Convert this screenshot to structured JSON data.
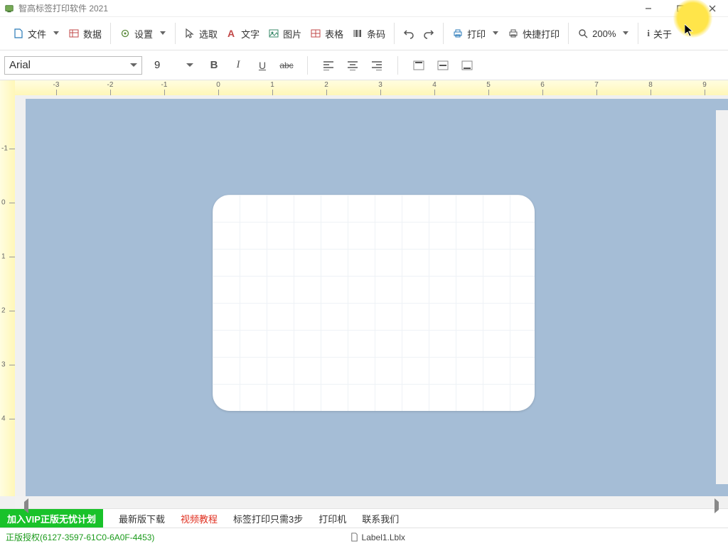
{
  "window": {
    "title": "智高标签打印软件 2021"
  },
  "toolbar": {
    "file": "文件",
    "data": "数据",
    "settings": "设置",
    "select": "选取",
    "text": "文字",
    "image": "图片",
    "table": "表格",
    "barcode": "条码",
    "print": "打印",
    "quick_print": "快捷打印",
    "zoom": "200%",
    "about": "关于"
  },
  "format": {
    "font_name": "Arial",
    "font_size": "9"
  },
  "ruler_h": [
    "-3",
    "-2",
    "-1",
    "0",
    "1",
    "2",
    "3",
    "4",
    "5",
    "6",
    "7",
    "8",
    "9"
  ],
  "ruler_v": [
    "-1",
    "0",
    "1",
    "2",
    "3",
    "4"
  ],
  "links": {
    "vip": "加入VIP正版无忧计划",
    "latest": "最新版下载",
    "video": "视频教程",
    "steps": "标签打印只需3步",
    "printer": "打印机",
    "contact": "联系我们"
  },
  "status": {
    "license": "正版授权(6127-3597-61C0-6A0F-4453)",
    "file": "Label1.Lblx"
  },
  "colors": {
    "canvas_bg": "#a5bdd6",
    "vip": "#19c22a",
    "license": "#1a9a1a"
  }
}
